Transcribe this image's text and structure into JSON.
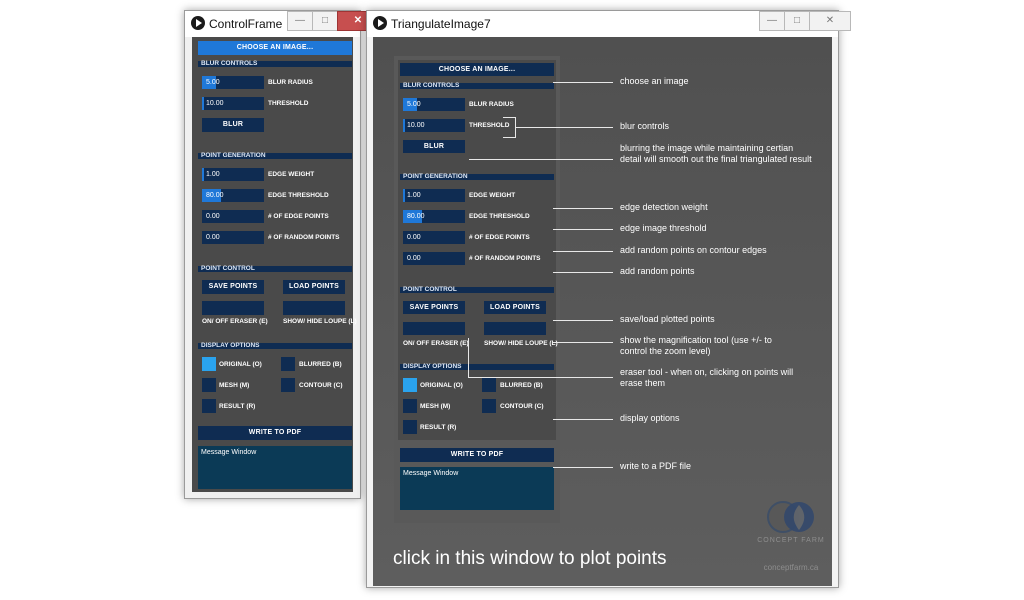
{
  "control_window": {
    "title": "ControlFrame",
    "choose_image": "CHOOSE AN IMAGE...",
    "blur_controls": {
      "header": "BLUR CONTROLS",
      "radius_value": "5.00",
      "radius_label": "BLUR RADIUS",
      "threshold_value": "10.00",
      "threshold_label": "THRESHOLD",
      "blur_button": "BLUR"
    },
    "point_generation": {
      "header": "POINT GENERATION",
      "edge_weight_value": "1.00",
      "edge_weight_label": "EDGE WEIGHT",
      "edge_threshold_value": "80.00",
      "edge_threshold_label": "EDGE THRESHOLD",
      "edge_points_value": "0.00",
      "edge_points_label": "# OF EDGE POINTS",
      "random_points_value": "0.00",
      "random_points_label": "# OF RANDOM POINTS"
    },
    "point_control": {
      "header": "POINT CONTROL",
      "save_points": "SAVE POINTS",
      "load_points": "LOAD POINTS",
      "eraser_label": "ON/ OFF ERASER (E)",
      "loupe_label": "SHOW/ HIDE LOUPE (L)"
    },
    "display_options": {
      "header": "DISPLAY OPTIONS",
      "original": "ORIGINAL (O)",
      "blurred": "BLURRED (B)",
      "mesh": "MESH (M)",
      "contour": "CONTOUR (C)",
      "result": "RESULT (R)"
    },
    "write_pdf": "WRITE TO PDF",
    "message_window": "Message Window"
  },
  "image_window": {
    "title": "TriangulateImage7",
    "annotations": {
      "choose": "choose an image",
      "blur": "blur controls",
      "blur_desc": "blurring the image while maintaining certian detail will smooth out the final triangulated result",
      "edge_weight": "edge detection weight",
      "edge_threshold": "edge image threshold",
      "edge_points": "add random points on contour edges",
      "random_points": "add random points",
      "save_load": "save/load plotted points",
      "loupe": "show the magnification tool (use +/- to control the zoom level)",
      "eraser": "eraser tool - when on, clicking on points will erase them",
      "display": "display options",
      "pdf": "write to a PDF file"
    },
    "instruction": "click in this window to plot points",
    "logo_text": "CONCEPT FARM",
    "logo_url": "conceptfarm.ca"
  }
}
